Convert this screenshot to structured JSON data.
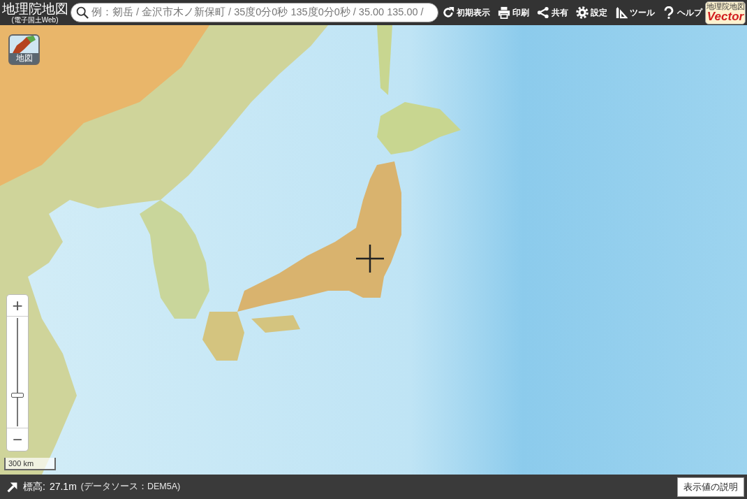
{
  "header": {
    "logo": {
      "title": "地理院地図",
      "subtitle": "(電子国土Web)"
    },
    "search": {
      "placeholder": "例：剱岳 / 金沢市木ノ新保町 / 35度0分0秒 135度0分0秒 / 35.00 135.00 /"
    },
    "toolbar": [
      {
        "kind": "reset",
        "label": "初期表示"
      },
      {
        "kind": "print",
        "label": "印刷"
      },
      {
        "kind": "share",
        "label": "共有"
      },
      {
        "kind": "settings",
        "label": "設定"
      },
      {
        "kind": "tools",
        "label": "ツール"
      },
      {
        "kind": "help",
        "label": "ヘルプ"
      }
    ],
    "vector_badge": {
      "title": "地理院地図",
      "label": "Vector"
    }
  },
  "map": {
    "layer_button": {
      "label": "地図"
    },
    "zoom": {
      "zoom_in": "+",
      "zoom_out": "−",
      "level": 0.28
    },
    "scale": "300 km"
  },
  "status_bar": {
    "label": "標高:",
    "value": "27.1m",
    "source": "(データソース：DEM5A)",
    "button": "表示値の説明"
  }
}
